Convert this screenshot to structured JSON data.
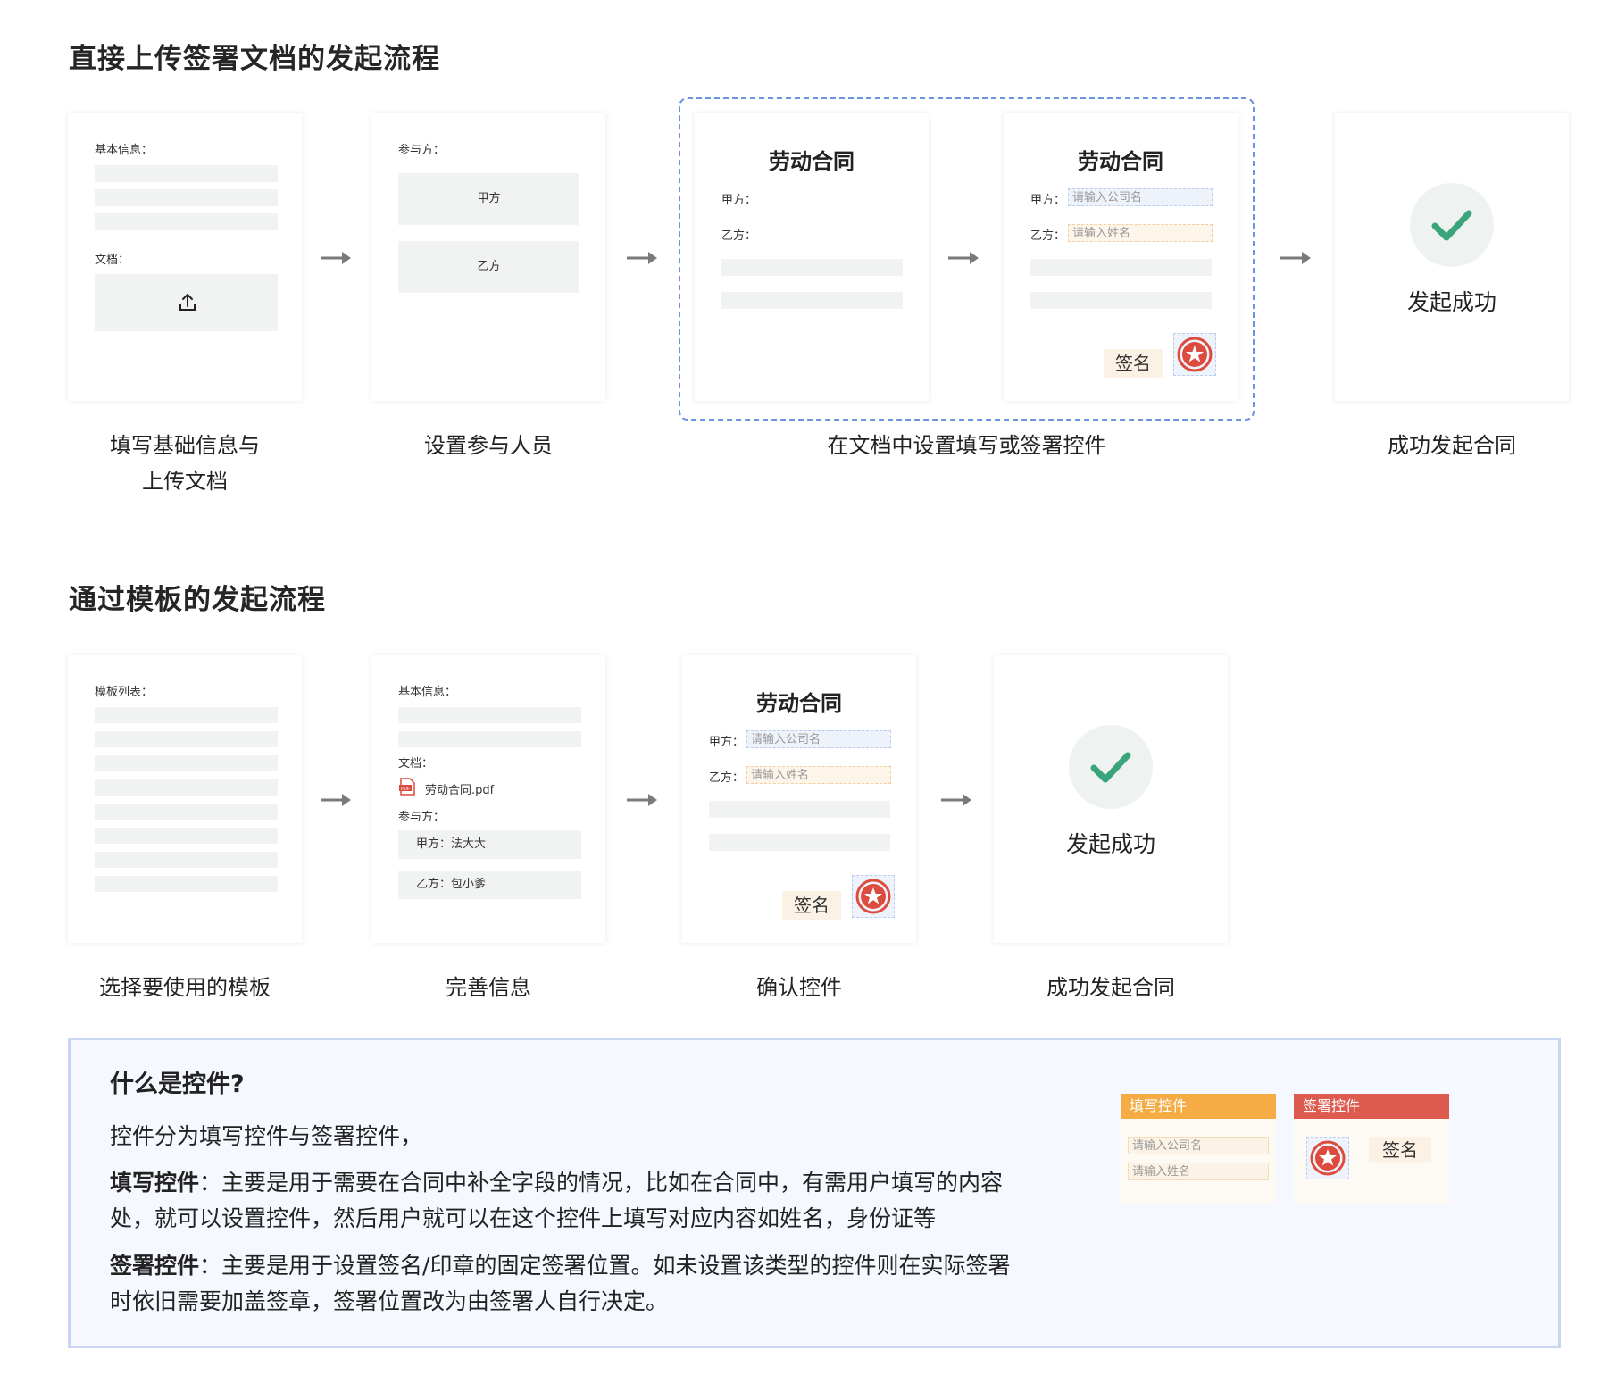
{
  "section1": {
    "title": "直接上传签署文档的发起流程",
    "step1": {
      "basic_label": "基本信息：",
      "doc_label": "文档：",
      "upload_icon": "upload-icon",
      "caption_line1": "填写基础信息与",
      "caption_line2": "上传文档"
    },
    "step2": {
      "participants_label": "参与方：",
      "party_a": "甲方",
      "party_b": "乙方",
      "caption": "设置参与人员"
    },
    "step3": {
      "doc_title": "劳动合同",
      "party_a_label": "甲方：",
      "party_b_label": "乙方：",
      "caption": "在文档中设置填写或签署控件"
    },
    "step3b": {
      "doc_title": "劳动合同",
      "party_a_label": "甲方：",
      "party_b_label": "乙方：",
      "company_placeholder": "请输入公司名",
      "name_placeholder": "请输入姓名",
      "sign_label": "签名"
    },
    "step4": {
      "success_text": "发起成功",
      "caption": "成功发起合同"
    }
  },
  "section2": {
    "title": "通过模板的发起流程",
    "step1": {
      "list_label": "模板列表：",
      "caption": "选择要使用的模板"
    },
    "step2": {
      "basic_label": "基本信息：",
      "doc_label": "文档：",
      "file_name": "劳动合同.pdf",
      "participants_label": "参与方：",
      "party_a": "甲方：法大大",
      "party_b": "乙方：包小爹",
      "caption": "完善信息"
    },
    "step3": {
      "doc_title": "劳动合同",
      "party_a_label": "甲方：",
      "party_b_label": "乙方：",
      "company_placeholder": "请输入公司名",
      "name_placeholder": "请输入姓名",
      "sign_label": "签名",
      "caption": "确认控件"
    },
    "step4": {
      "success_text": "发起成功",
      "caption": "成功发起合同"
    }
  },
  "info": {
    "title": "什么是控件?",
    "intro": "控件分为填写控件与签署控件，",
    "fill_term": "填写控件",
    "fill_line1": "：主要是用于需要在合同中补全字段的情况，比如在合同中，有需用户填写的内容",
    "fill_line2": "处，就可以设置控件，然后用户就可以在这个控件上填写对应内容如姓名，身份证等",
    "sign_term": "签署控件",
    "sign_line1": "：主要是用于设置签名/印章的固定签署位置。如未设置该类型的控件则在实际签署",
    "sign_line2": "时依旧需要加盖签章，签署位置改为由签署人自行决定。",
    "fill_widget": {
      "header": "填写控件",
      "company_placeholder": "请输入公司名",
      "name_placeholder": "请输入姓名"
    },
    "sign_widget": {
      "header": "签署控件",
      "sign_label": "签名"
    }
  },
  "colors": {
    "fill_header": "#f5ac44",
    "sign_header": "#dd5a4e",
    "seal_red": "#dc4b3e",
    "check_green": "#3aa57a",
    "dashed_blue": "#6b93e0"
  }
}
